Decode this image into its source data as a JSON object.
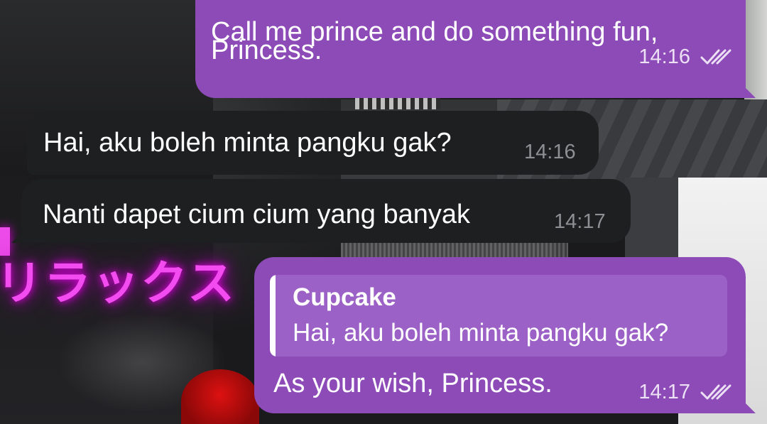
{
  "messages": [
    {
      "direction": "outgoing",
      "lines": [
        "Call me prince and do something fun,",
        "Princess."
      ],
      "time": "14:16",
      "status_icon": "double-check-icon"
    },
    {
      "direction": "incoming",
      "text": "Hai, aku boleh minta pangku gak?",
      "time": "14:16"
    },
    {
      "direction": "incoming",
      "text": "Nanti dapet cium cium yang banyak",
      "time": "14:17"
    },
    {
      "direction": "outgoing",
      "reply_to": {
        "sender": "Cupcake",
        "text": "Hai, aku boleh minta pangku gak?"
      },
      "text": "As your wish, Princess.",
      "time": "14:17",
      "status_icon": "double-check-icon"
    }
  ],
  "wallpaper": {
    "neon_sign_text": "リラックス"
  },
  "colors": {
    "outgoing_bubble": "#8d4bb8",
    "incoming_bubble": "#1e1f21",
    "reply_quote_bg": "#9b61c6",
    "neon": "#f24bf0"
  }
}
